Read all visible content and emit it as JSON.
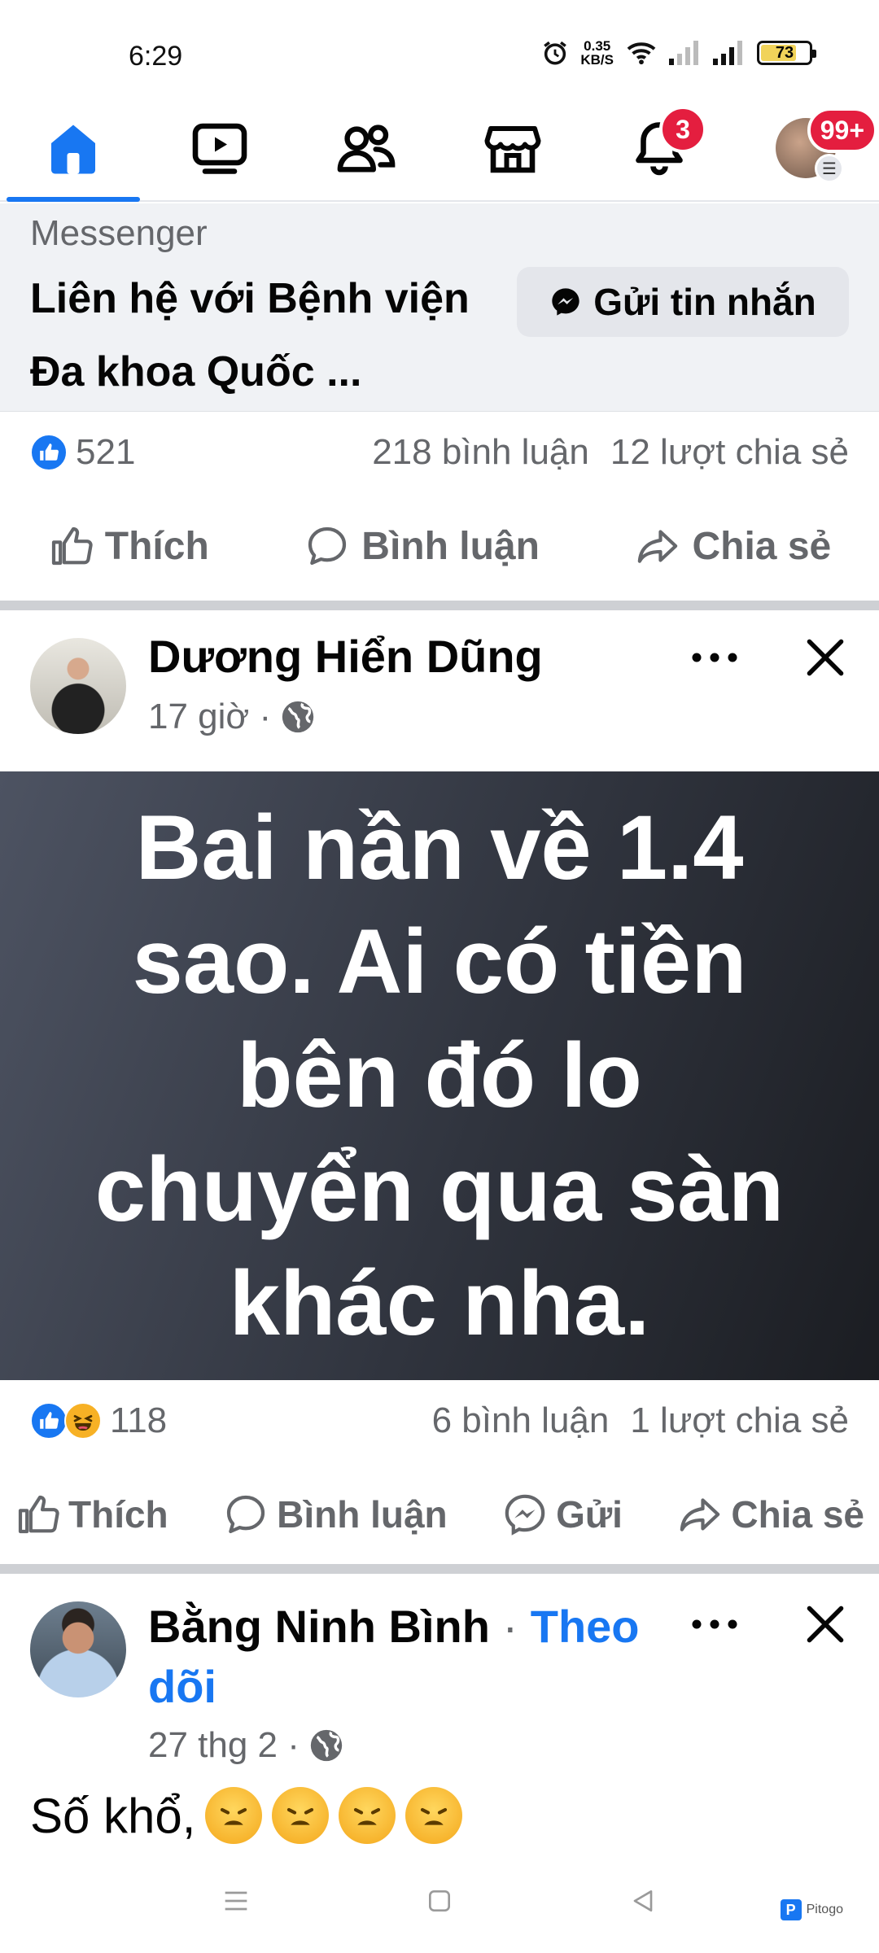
{
  "status_bar": {
    "time": "6:29",
    "net_speed_value": "0.35",
    "net_speed_unit": "KB/S",
    "battery": "73"
  },
  "topnav": {
    "tabs": [
      "home",
      "watch",
      "friends",
      "marketplace",
      "notifications",
      "menu"
    ],
    "notifications_badge": "3",
    "menu_badge": "99+"
  },
  "messenger_card": {
    "source": "Messenger",
    "title": "Liên hệ với Bệnh viện Đa khoa Quốc ...",
    "button": "Gửi tin nhắn"
  },
  "post1_stats": {
    "reactions": "521",
    "comments": "218 bình luận",
    "shares": "12 lượt chia sẻ"
  },
  "post1_actions": {
    "like": "Thích",
    "comment": "Bình luận",
    "share": "Chia sẻ"
  },
  "post2": {
    "author": "Dương Hiển Dũng",
    "time": "17 giờ ·",
    "text": "Bai nần về 1.4 sao. Ai có tiền bên đó lo chuyển qua sàn khác nha.",
    "reactions": "118",
    "comments": "6 bình luận",
    "shares": "1 lượt chia sẻ",
    "actions": {
      "like": "Thích",
      "comment": "Bình luận",
      "send": "Gửi",
      "share": "Chia sẻ"
    }
  },
  "post3": {
    "author": "Bằng Ninh Bình",
    "separator": "·",
    "follow_1": "Theo",
    "follow_2": "dõi",
    "time": "27 thg 2 ·",
    "text": "Số khổ,"
  },
  "watermark": "Pitogo",
  "colors": {
    "accent": "#1877f2",
    "badge": "#e41e3f",
    "muted": "#65676b"
  }
}
